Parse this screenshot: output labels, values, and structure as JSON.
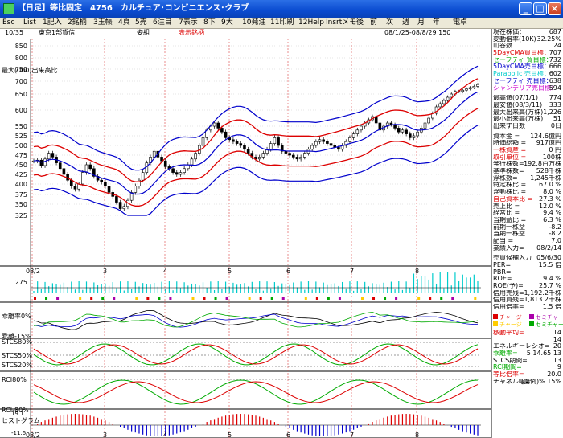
{
  "window": {
    "title": "【日足】等比固定　4756　カルチュア･コンビニエンス･クラブ",
    "buttons": [
      "_",
      "□",
      "×"
    ]
  },
  "menu": [
    "Esc",
    "List",
    "1記入",
    "2銘柄",
    "3玉帳",
    "4頁",
    "5売",
    "6注目",
    "7表示",
    "8下",
    "9大",
    "10発注",
    "11印刷",
    "12Help",
    "Insrtメモ",
    "後",
    "前",
    "次",
    "週",
    "月",
    "年",
    "電卓"
  ],
  "chart_header": {
    "time": "10/35",
    "market": "東京1部貨信",
    "note": "姿組",
    "mode": "表示銘柄",
    "period": "08/1/25-08/8/29 150"
  },
  "axes": {
    "price_ticks": [
      "850",
      "800",
      "750",
      "700",
      "650",
      "600",
      "550",
      "525",
      "500",
      "475",
      "450",
      "425",
      "400",
      "375",
      "350",
      "325"
    ],
    "volume_label": "最大(000)出来高比",
    "volume_ticks": [
      "275"
    ],
    "deviation_label": "乖離率0%",
    "deviation_low": "乖離-15%",
    "stoch_labels": [
      "STCS80%",
      "STCS50%",
      "STCS20%"
    ],
    "rci_labels": [
      "RCI80%",
      "RCI-80%"
    ],
    "hist_label": "ヒストグラム",
    "hist_top": "19.1",
    "hist_bottom": "-11.6",
    "x_labels": [
      "08/2",
      "3",
      "4",
      "5",
      "6",
      "7",
      "8"
    ]
  },
  "info": {
    "rows1": [
      {
        "l": "現在株価：",
        "v": "687",
        "c": "#000"
      },
      {
        "l": "変動倍率(10K)",
        "v": "32.25%",
        "c": "#000"
      },
      {
        "l": "山谷数",
        "v": "24",
        "c": "#000"
      },
      {
        "l": "5DayCMA買目標：",
        "v": "707",
        "c": "#d00"
      },
      {
        "l": "セーフティ 買目標：",
        "v": "732",
        "c": "#0a0"
      },
      {
        "l": "5DayCMA売目標：",
        "v": "666",
        "c": "#00c"
      },
      {
        "l": "Parabolic 売目標：",
        "v": "602",
        "c": "#0cc"
      },
      {
        "l": "セーフティ 売目標：",
        "v": "638",
        "c": "#00c"
      },
      {
        "l": "シャンデリア売目標：",
        "v": "594",
        "c": "#c0c"
      }
    ],
    "rows2": [
      {
        "l": "最高値(07/1/1)",
        "v": "774",
        "c": "#000"
      },
      {
        "l": "最安値(08/3/11)",
        "v": "333",
        "c": "#000"
      },
      {
        "l": "最大出来高(万株)",
        "v": "1,226",
        "c": "#000"
      },
      {
        "l": "最小出来高(万株)",
        "v": "51",
        "c": "#000"
      },
      {
        "l": "出来ず日数",
        "v": "0日",
        "c": "#000"
      }
    ],
    "rows3": [
      {
        "l": "資本金 =",
        "v": "124.6億円",
        "c": "#000"
      },
      {
        "l": "時価総額 =",
        "v": "917億円",
        "c": "#000"
      },
      {
        "l": "一株資産 =",
        "v": "0 円",
        "c": "#d00"
      },
      {
        "l": "取引単位 =",
        "v": "100株",
        "c": "#d00"
      },
      {
        "l": "発行株数=",
        "v": "192.8百万株",
        "c": "#000"
      },
      {
        "l": "基準株数=",
        "v": "528千株",
        "c": "#000"
      },
      {
        "l": "浮株数=",
        "v": "1,245千株",
        "c": "#000"
      },
      {
        "l": "特定株比 =",
        "v": "67.0 %",
        "c": "#000"
      },
      {
        "l": "浮動株比 =",
        "v": "8.0 %",
        "c": "#000"
      },
      {
        "l": "自己資本比 =",
        "v": "27.3 %",
        "c": "#d00"
      },
      {
        "l": "売上比 =",
        "v": "12.0 %",
        "c": "#000"
      },
      {
        "l": "経常比 =",
        "v": "9.4 %",
        "c": "#000"
      },
      {
        "l": "当期益比 =",
        "v": "6.3 %",
        "c": "#000"
      },
      {
        "l": "前期一株益",
        "v": "-8.2",
        "c": "#000"
      },
      {
        "l": "当期一株益",
        "v": "-8.2",
        "c": "#000"
      },
      {
        "l": "配当 =",
        "v": "7.0",
        "c": "#000"
      },
      {
        "l": "業績入力=",
        "v": "08/2/14",
        "c": "#000"
      }
    ],
    "rows4": [
      {
        "l": "売買候補入力",
        "v": "05/6/30",
        "c": "#000"
      },
      {
        "l": "PER=",
        "v": "15.5 倍",
        "c": "#000"
      },
      {
        "l": "PBR=",
        "v": "",
        "c": "#000"
      },
      {
        "l": "ROE=",
        "v": "9.4 %",
        "c": "#000"
      },
      {
        "l": "ROE(予)=",
        "v": "25.7 %",
        "c": "#000"
      },
      {
        "l": "信用売残=",
        "v": "1,192.2千株",
        "c": "#000"
      },
      {
        "l": "信用買残=",
        "v": "1,813.2千株",
        "c": "#000"
      },
      {
        "l": "信用倍率=",
        "v": "1.5 倍",
        "c": "#000"
      }
    ],
    "legend": [
      {
        "l": "チャージ",
        "c": "#d00"
      },
      {
        "l": "セミチャージ",
        "c": "#a0a"
      },
      {
        "l": "チャージ",
        "c": "#fc0"
      },
      {
        "l": "セミチャージ",
        "c": "#0a0"
      }
    ],
    "rows5": [
      {
        "l": "移動平均=",
        "v": "14",
        "c": "#d00"
      },
      {
        "l": "",
        "v": "14",
        "c": "#00c"
      },
      {
        "l": "エネルギーレシオ=",
        "v": "20",
        "c": "#000"
      },
      {
        "l": "乖離率=",
        "v": "5  14.65 13",
        "c": "#0a0"
      },
      {
        "l": "STCS期間=",
        "v": "13",
        "c": "#000"
      },
      {
        "l": "RCI期間=",
        "v": "9",
        "c": "#0a0"
      },
      {
        "l": "等比倍率=",
        "v": "20.0",
        "c": "#d00"
      },
      {
        "l": "チャネル幅=",
        "v": "(面倒)% 15%",
        "c": "#000"
      }
    ]
  }
}
